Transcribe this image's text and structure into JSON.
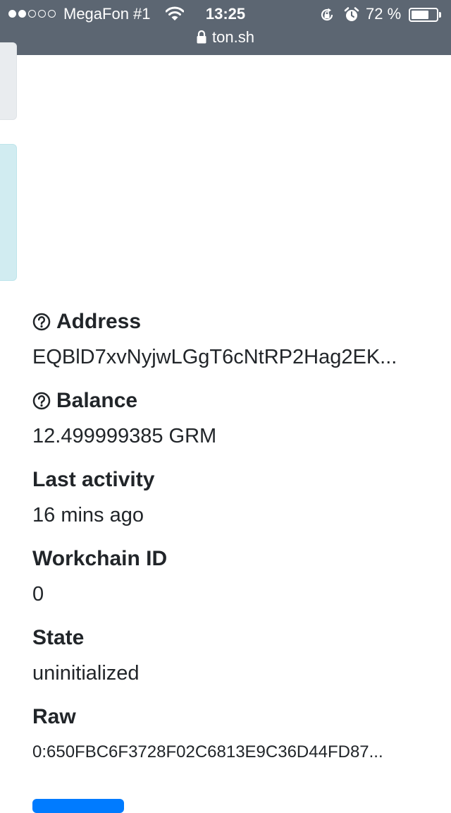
{
  "status_bar": {
    "signal_filled": 2,
    "signal_total": 5,
    "carrier": "MegaFon #1",
    "time": "13:25",
    "battery_percent_label": "72 %",
    "battery_level": 0.72,
    "url": "ton.sh",
    "icons": [
      "wifi-icon",
      "lock-rotation-icon",
      "alarm-icon",
      "battery-icon",
      "padlock-icon"
    ]
  },
  "account": {
    "address_label": "Address",
    "address_value": "EQBlD7xvNyjwLGgT6cNtRP2Hag2EK...",
    "balance_label": "Balance",
    "balance_value": "12.499999385 GRM",
    "last_activity_label": "Last activity",
    "last_activity_value": "16 mins ago",
    "workchain_label": "Workchain ID",
    "workchain_value": "0",
    "state_label": "State",
    "state_value": "uninitialized",
    "raw_label": "Raw",
    "raw_value": "0:650FBC6F3728F02C6813E9C36D44FD87..."
  },
  "colors": {
    "status_bar_bg": "#5c6672",
    "info_panel_bg": "#d1ecf1",
    "grey_panel_bg": "#e9ecef",
    "button_primary": "#007bff",
    "text": "#212529"
  }
}
